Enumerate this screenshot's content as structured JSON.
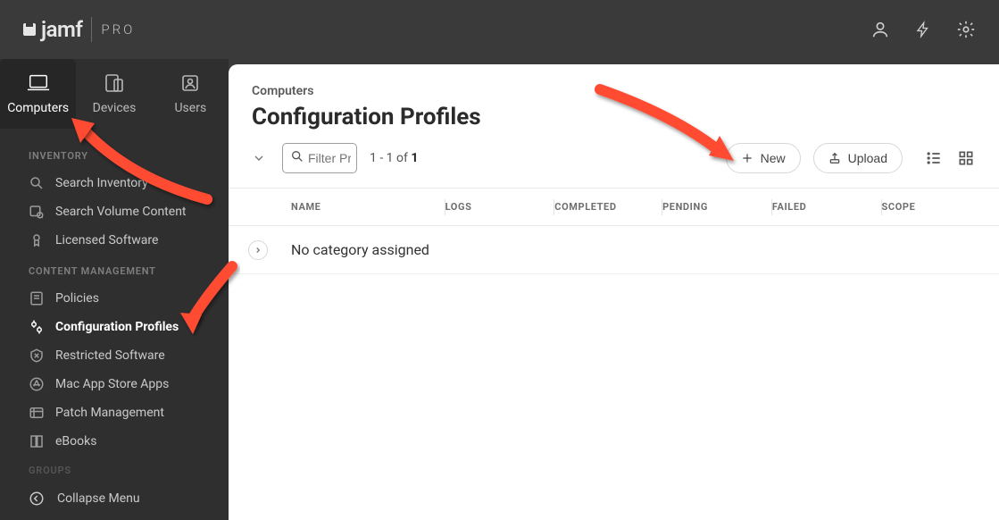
{
  "brand": {
    "name": "jamf",
    "suffix": "PRO"
  },
  "top_tabs": [
    {
      "label": "Computers",
      "active": true
    },
    {
      "label": "Devices",
      "active": false
    },
    {
      "label": "Users",
      "active": false
    }
  ],
  "sidebar": {
    "section1_title": "INVENTORY",
    "inventory": [
      {
        "label": "Search Inventory"
      },
      {
        "label": "Search Volume Content"
      },
      {
        "label": "Licensed Software"
      }
    ],
    "section2_title": "CONTENT MANAGEMENT",
    "content": [
      {
        "label": "Policies"
      },
      {
        "label": "Configuration Profiles",
        "active": true
      },
      {
        "label": "Restricted Software"
      },
      {
        "label": "Mac App Store Apps"
      },
      {
        "label": "Patch Management"
      },
      {
        "label": "eBooks"
      }
    ],
    "section3_title": "GROUPS",
    "collapse_label": "Collapse Menu"
  },
  "main": {
    "breadcrumb": "Computers",
    "title": "Configuration Profiles",
    "filter_placeholder": "Filter Pr",
    "count_prefix": "1 - 1 of ",
    "count_total": "1",
    "new_label": "New",
    "upload_label": "Upload",
    "columns": {
      "name": "NAME",
      "logs": "LOGS",
      "completed": "COMPLETED",
      "pending": "PENDING",
      "failed": "FAILED",
      "scope": "SCOPE"
    },
    "row_text": "No category assigned"
  }
}
